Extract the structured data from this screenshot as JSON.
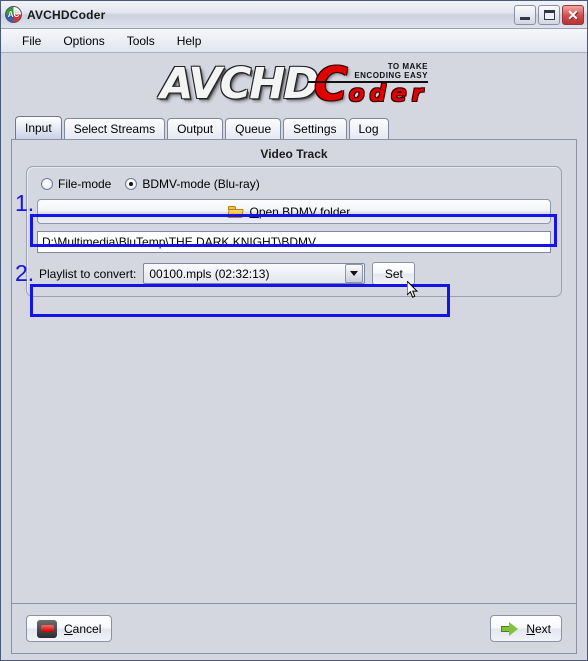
{
  "window": {
    "title": "AVCHDCoder",
    "app_icon": "avchdcoder-app-icon",
    "minimize_label": "_",
    "maximize_label": "",
    "close_label": "✕"
  },
  "menu": {
    "items": [
      {
        "label": "File"
      },
      {
        "label": "Options"
      },
      {
        "label": "Tools"
      },
      {
        "label": "Help"
      }
    ]
  },
  "logo": {
    "part1": "AVCHD",
    "part2": "C",
    "part3": "oder",
    "tagline_line1": "TO MAKE",
    "tagline_line2": "ENCODING EASY"
  },
  "tabs": [
    {
      "label": "Input",
      "active": true
    },
    {
      "label": "Select Streams",
      "active": false
    },
    {
      "label": "Output",
      "active": false
    },
    {
      "label": "Queue",
      "active": false
    },
    {
      "label": "Settings",
      "active": false
    },
    {
      "label": "Log",
      "active": false
    }
  ],
  "main": {
    "section_title": "Video Track",
    "mode": {
      "file_mode_label": "File-mode",
      "bdmv_mode_label": "BDMV-mode (Blu-ray)",
      "selected": "bdmv"
    },
    "open_folder": {
      "label_pre": "O",
      "label_post": "pen BDMV folder...",
      "icon": "open-folder-icon"
    },
    "path_field": {
      "value": "D:\\Multimedia\\BluTemp\\THE DARK KNIGHT\\BDMV",
      "placeholder": ""
    },
    "playlist": {
      "label": "Playlist to convert:",
      "selected": "00100.mpls (02:32:13)",
      "options": [
        "00100.mpls (02:32:13)"
      ],
      "set_button_label": "Set"
    }
  },
  "annotations": {
    "step1": "1.",
    "step2": "2.",
    "color": "#1414e6"
  },
  "footer": {
    "cancel_pre": "C",
    "cancel_post": "ancel",
    "next_pre": "N",
    "next_post": "ext"
  }
}
